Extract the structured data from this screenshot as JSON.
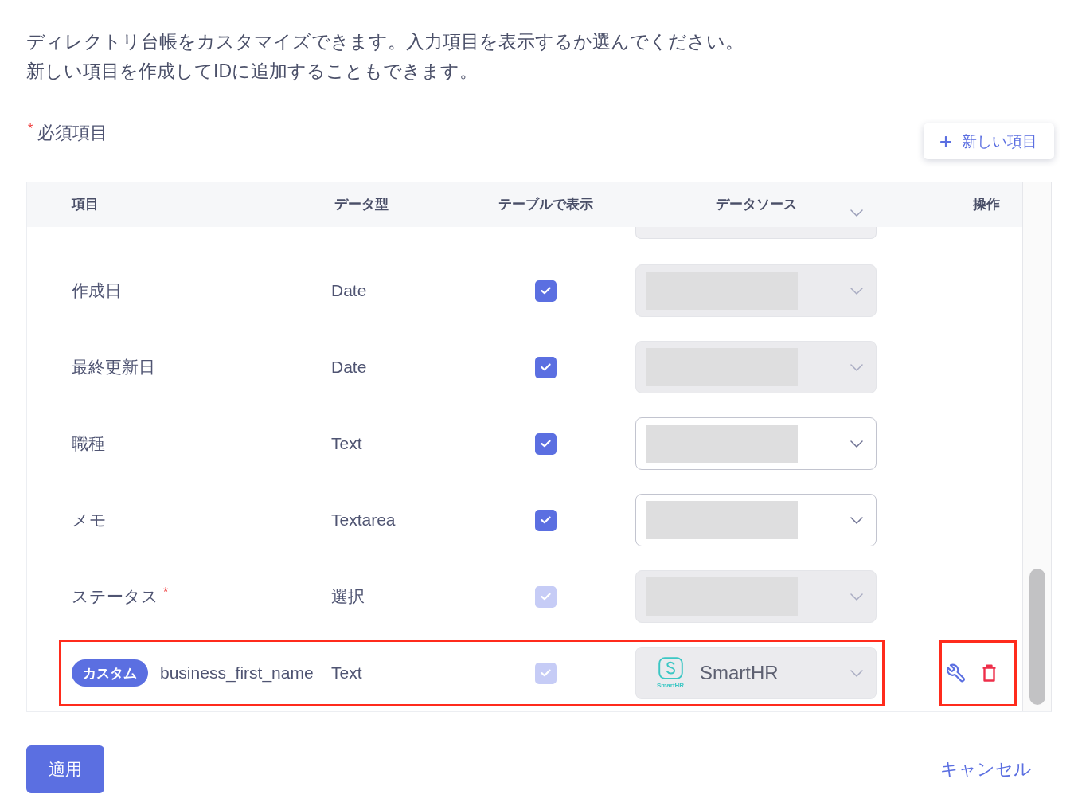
{
  "intro": {
    "lines": [
      "ディレクトリ台帳をカスタマイズできます。入力項目を表示するか選んでください。",
      "新しい項目を作成してIDに追加することもできます。"
    ]
  },
  "required_legend": {
    "mark": "*",
    "label": "必須項目"
  },
  "new_item_button": {
    "label": "新しい項目"
  },
  "table": {
    "columns": [
      "項目",
      "データ型",
      "テーブルで表示",
      "データソース",
      "操作"
    ],
    "rows": [
      {
        "kind": "standard",
        "name": "作成日",
        "type": "Date",
        "show_in_table": {
          "checked": true,
          "disabled": false
        },
        "source": {
          "disabled": true,
          "redacted": true
        }
      },
      {
        "kind": "standard",
        "name": "最終更新日",
        "type": "Date",
        "show_in_table": {
          "checked": true,
          "disabled": false
        },
        "source": {
          "disabled": true,
          "redacted": true
        }
      },
      {
        "kind": "standard",
        "name": "職種",
        "type": "Text",
        "show_in_table": {
          "checked": true,
          "disabled": false
        },
        "source": {
          "disabled": false,
          "redacted": true
        }
      },
      {
        "kind": "standard",
        "name": "メモ",
        "type": "Textarea",
        "show_in_table": {
          "checked": true,
          "disabled": false
        },
        "source": {
          "disabled": false,
          "redacted": true
        }
      },
      {
        "kind": "standard",
        "name": "ステータス",
        "required_mark": "*",
        "type": "選択",
        "show_in_table": {
          "checked": true,
          "disabled": true
        },
        "source": {
          "disabled": true,
          "redacted": true
        }
      },
      {
        "kind": "custom",
        "badge": "カスタム",
        "name": "business_first_name",
        "type": "Text",
        "show_in_table": {
          "checked": true,
          "disabled": true
        },
        "source": {
          "disabled": true,
          "logo_caption": "SmartHR",
          "value": "SmartHR"
        },
        "editable": true,
        "deletable": true,
        "highlighted": true,
        "actions_highlighted": true
      }
    ]
  },
  "footer": {
    "apply_button": "適用",
    "cancel_link": "キャンセル"
  }
}
